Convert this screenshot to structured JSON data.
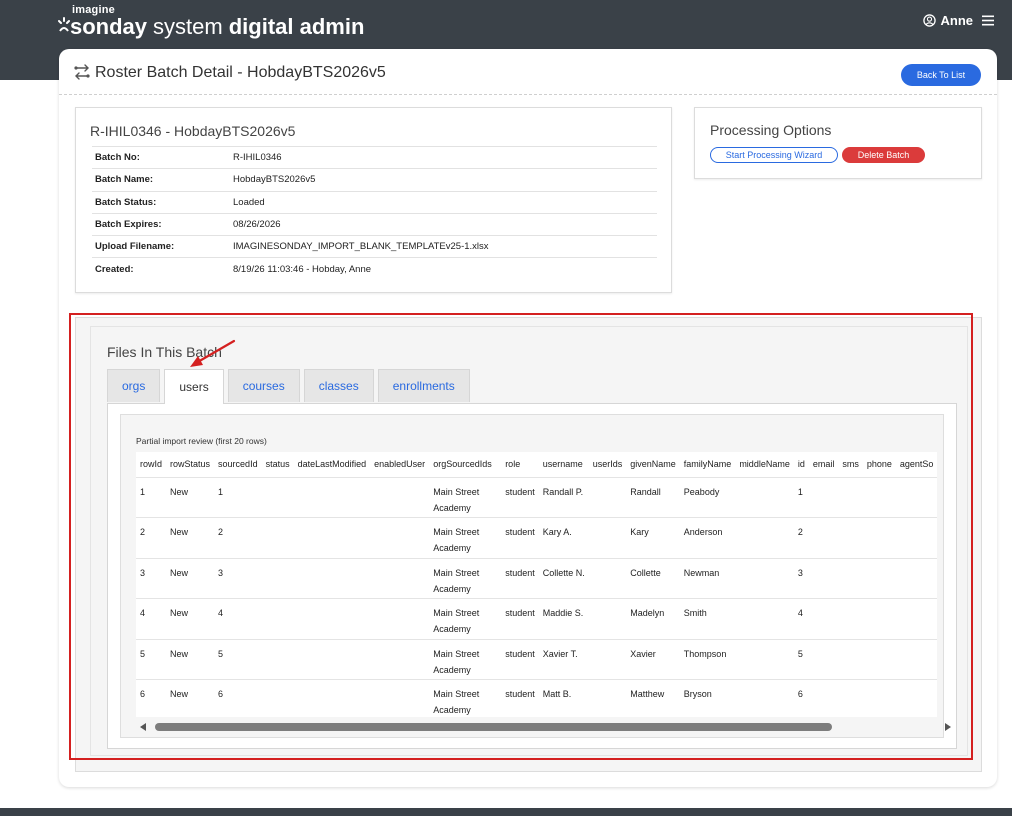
{
  "header": {
    "logo_small": "imagine",
    "logo_part1": "sonday",
    "logo_part2": "system",
    "logo_part3": "digital admin",
    "user_name": "Anne",
    "user_icon": "user-circle-icon",
    "menu_icon": "hamburger-icon"
  },
  "page": {
    "title": "Roster Batch Detail - HobdayBTS2026v5",
    "title_icon": "transfer-arrows-icon",
    "back_label": "Back To List"
  },
  "batch": {
    "heading": "R-IHIL0346 - HobdayBTS2026v5",
    "fields": [
      {
        "label": "Batch No:",
        "value": "R-IHIL0346"
      },
      {
        "label": "Batch Name:",
        "value": "HobdayBTS2026v5"
      },
      {
        "label": "Batch Status:",
        "value": "Loaded"
      },
      {
        "label": "Batch Expires:",
        "value": "08/26/2026"
      },
      {
        "label": "Upload Filename:",
        "value": "IMAGINESONDAY_IMPORT_BLANK_TEMPLATEv25-1.xlsx"
      },
      {
        "label": "Created:",
        "value": "8/19/26 11:03:46 - Hobday, Anne"
      }
    ]
  },
  "processing": {
    "title": "Processing Options",
    "wizard_label": "Start Processing Wizard",
    "delete_label": "Delete Batch"
  },
  "files": {
    "title": "Files In This Batch",
    "tabs": [
      "orgs",
      "users",
      "courses",
      "classes",
      "enrollments"
    ],
    "active_tab": "users",
    "preview_label": "Partial import review (first 20 rows)",
    "columns": [
      "rowId",
      "rowStatus",
      "sourcedId",
      "status",
      "dateLastModified",
      "enabledUser",
      "orgSourcedIds",
      "role",
      "username",
      "userIds",
      "givenName",
      "familyName",
      "middleName",
      "id",
      "email",
      "sms",
      "phone",
      "agentSo"
    ],
    "rows": [
      [
        "1",
        "New",
        "1",
        "",
        "",
        "",
        "Main Street Academy",
        "student",
        "Randall P.",
        "",
        "Randall",
        "Peabody",
        "",
        "1",
        "",
        "",
        "",
        ""
      ],
      [
        "2",
        "New",
        "2",
        "",
        "",
        "",
        "Main Street Academy",
        "student",
        "Kary A.",
        "",
        "Kary",
        "Anderson",
        "",
        "2",
        "",
        "",
        "",
        ""
      ],
      [
        "3",
        "New",
        "3",
        "",
        "",
        "",
        "Main Street Academy",
        "student",
        "Collette N.",
        "",
        "Collette",
        "Newman",
        "",
        "3",
        "",
        "",
        "",
        ""
      ],
      [
        "4",
        "New",
        "4",
        "",
        "",
        "",
        "Main Street Academy",
        "student",
        "Maddie S.",
        "",
        "Madelyn",
        "Smith",
        "",
        "4",
        "",
        "",
        "",
        ""
      ],
      [
        "5",
        "New",
        "5",
        "",
        "",
        "",
        "Main Street Academy",
        "student",
        "Xavier T.",
        "",
        "Xavier",
        "Thompson",
        "",
        "5",
        "",
        "",
        "",
        ""
      ],
      [
        "6",
        "New",
        "6",
        "",
        "",
        "",
        "Main Street Academy",
        "student",
        "Matt B.",
        "",
        "Matthew",
        "Bryson",
        "",
        "6",
        "",
        "",
        "",
        ""
      ]
    ]
  },
  "colors": {
    "topbar": "#3a4148",
    "primary": "#2a6ae0",
    "danger": "#db3b3b",
    "annotation": "#d42020"
  }
}
